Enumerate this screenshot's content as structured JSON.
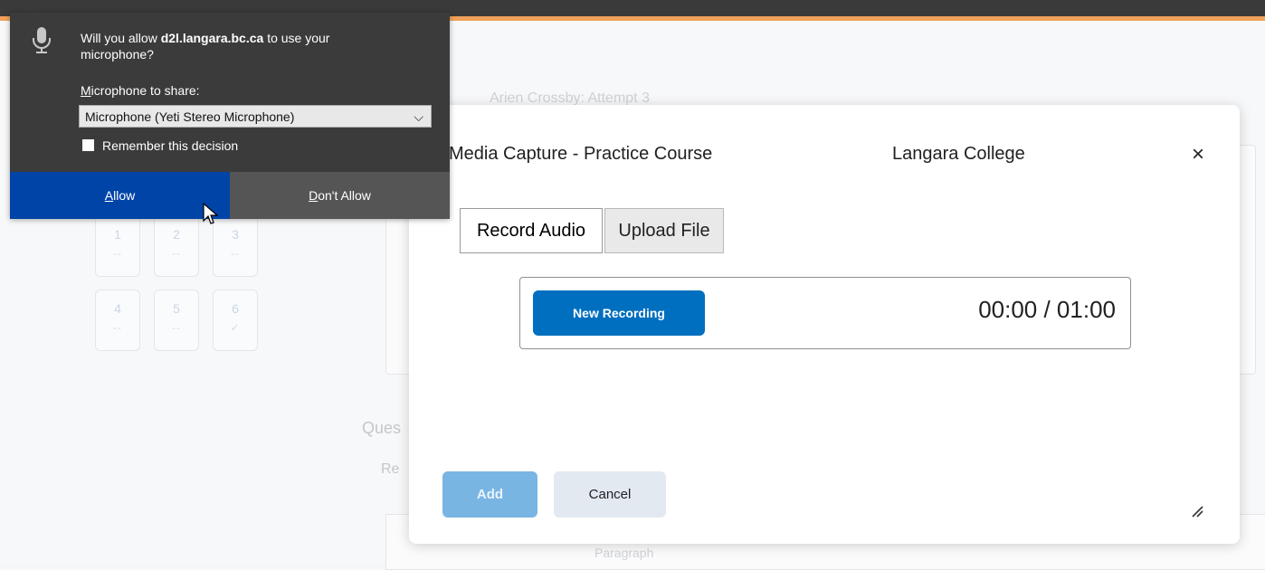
{
  "background": {
    "attempt_title": "Arien Crossby: Attempt 3",
    "question_grid": [
      {
        "number": "1",
        "status": "--"
      },
      {
        "number": "2",
        "status": "--"
      },
      {
        "number": "3",
        "status": "--"
      },
      {
        "number": "4",
        "status": "--"
      },
      {
        "number": "5",
        "status": "--"
      },
      {
        "number": "6",
        "status": "✓"
      }
    ],
    "question_label": "Ques",
    "response_label": "Re",
    "toolbar_paragraph": "Paragraph"
  },
  "modal": {
    "title": "Media Capture - Practice Course",
    "org": "Langara College",
    "close_label": "×",
    "tabs": [
      {
        "label": "Record Audio",
        "active": true
      },
      {
        "label": "Upload File",
        "active": false
      }
    ],
    "new_recording_label": "New Recording",
    "timer": "00:00 / 01:00",
    "add_label": "Add",
    "cancel_label": "Cancel"
  },
  "permission_popup": {
    "question_prefix": "Will you allow ",
    "domain": "d2l.langara.bc.ca",
    "question_suffix": " to use your microphone?",
    "mic_label_accel": "M",
    "mic_label_rest": "icrophone to share:",
    "selected_device": "Microphone (Yeti Stereo Microphone)",
    "remember_label": "Remember this decision",
    "remember_checked": false,
    "allow_accel": "A",
    "allow_rest": "llow",
    "deny_accel": "D",
    "deny_rest": "on't Allow"
  },
  "colors": {
    "primary_blue": "#006fbf",
    "allow_blue": "#0044a8",
    "accent_orange": "#f2a25a",
    "popup_bg": "#3b3b3b"
  }
}
